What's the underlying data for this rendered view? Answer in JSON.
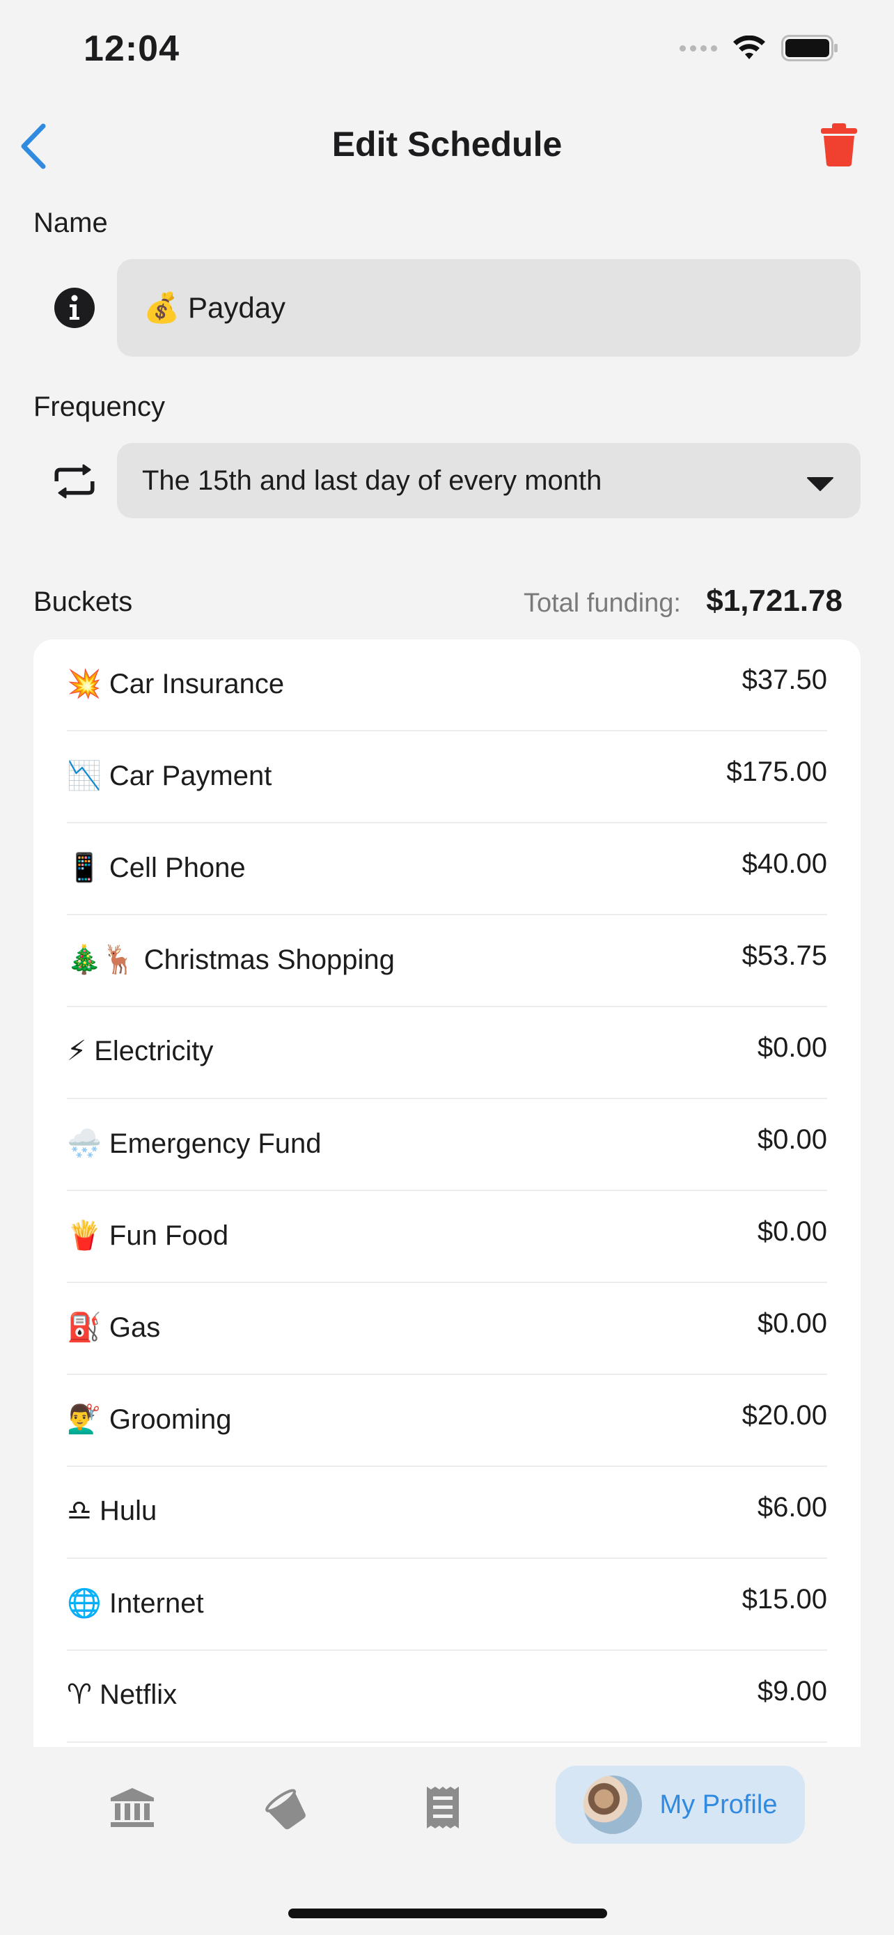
{
  "status_bar": {
    "time": "12:04"
  },
  "header": {
    "title": "Edit Schedule"
  },
  "name_section": {
    "label": "Name",
    "value": "💰 Payday"
  },
  "frequency_section": {
    "label": "Frequency",
    "value": "The 15th and last day of every month"
  },
  "buckets_section": {
    "label": "Buckets",
    "total_label": "Total funding:",
    "total_value": "$1,721.78",
    "items": [
      {
        "name": "💥 Car Insurance",
        "amount": "$37.50"
      },
      {
        "name": "📉 Car Payment",
        "amount": "$175.00"
      },
      {
        "name": "📱 Cell Phone",
        "amount": "$40.00"
      },
      {
        "name": "🎄🦌 Christmas Shopping",
        "amount": "$53.75"
      },
      {
        "name": "⚡ Electricity",
        "amount": "$0.00"
      },
      {
        "name": "🌨️ Emergency Fund",
        "amount": "$0.00"
      },
      {
        "name": "🍟 Fun Food",
        "amount": "$0.00"
      },
      {
        "name": "⛽ Gas",
        "amount": "$0.00"
      },
      {
        "name": "💇‍♂️ Grooming",
        "amount": "$20.00"
      },
      {
        "name": "♎ Hulu",
        "amount": "$6.00"
      },
      {
        "name": "🌐 Internet",
        "amount": "$15.00"
      },
      {
        "name": "♈ Netflix",
        "amount": "$9.00"
      }
    ]
  },
  "tab_bar": {
    "tabs": [
      {
        "icon": "bank-icon"
      },
      {
        "icon": "bucket-icon"
      },
      {
        "icon": "receipt-icon"
      },
      {
        "icon": "avatar",
        "label": "My Profile"
      }
    ]
  },
  "colors": {
    "accent": "#2f8ae0",
    "danger": "#f04030",
    "field_bg": "#e3e3e3",
    "profile_tab_bg": "#d6e6f5"
  }
}
